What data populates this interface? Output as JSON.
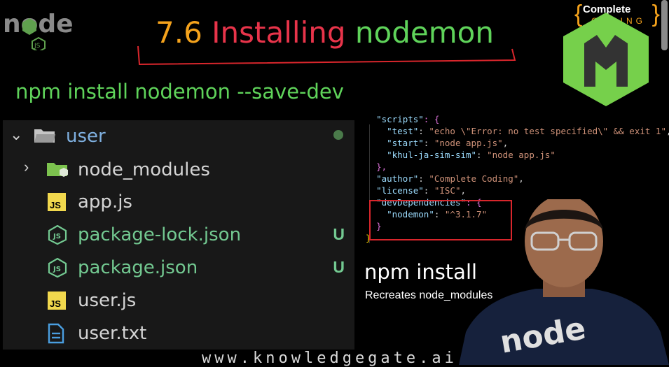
{
  "slide": {
    "title_number": "7.6",
    "title_word1": "Installing",
    "title_word2": "nodemon",
    "command": "npm install nodemon --save-dev",
    "npm_install_heading": "npm install",
    "npm_install_caption": "Recreates node_modules",
    "website": "www.knowledgegate.ai"
  },
  "logo": {
    "node_text": "node",
    "js_text": "JS"
  },
  "brand": {
    "top": "Complete",
    "bottom": "CODING"
  },
  "explorer": {
    "folder": "user",
    "items": [
      {
        "name": "node_modules",
        "icon": "folder-icon",
        "status": ""
      },
      {
        "name": "app.js",
        "icon": "js-file-icon",
        "status": ""
      },
      {
        "name": "package-lock.json",
        "icon": "node-js-file-icon",
        "status": "U"
      },
      {
        "name": "package.json",
        "icon": "node-js-file-icon",
        "status": "U"
      },
      {
        "name": "user.js",
        "icon": "js-file-icon",
        "status": ""
      },
      {
        "name": "user.txt",
        "icon": "text-file-icon",
        "status": ""
      }
    ]
  },
  "code": {
    "l1k": "\"scripts\"",
    "l1p": ": {",
    "l2k": "\"test\"",
    "l2v": "\"echo \\\"Error: no test specified\\\" && exit 1\"",
    "l3k": "\"start\"",
    "l3v": "\"node app.js\"",
    "l4k": "\"khul-ja-sim-sim\"",
    "l4v": "\"node app.js\"",
    "l5": "},",
    "l6k": "\"author\"",
    "l6v": "\"Complete Coding\"",
    "l7k": "\"license\"",
    "l7v": "\"ISC\"",
    "l8k": "\"devDependencies\"",
    "l8p": ": {",
    "l9k": "\"nodemon\"",
    "l9v": "\"^3.1.7\"",
    "l10": "}",
    "l11": "}"
  },
  "colors": {
    "green": "#5fd35a",
    "red": "#e8344a",
    "orange": "#f4a21c",
    "highlight_box": "#d9262c"
  }
}
